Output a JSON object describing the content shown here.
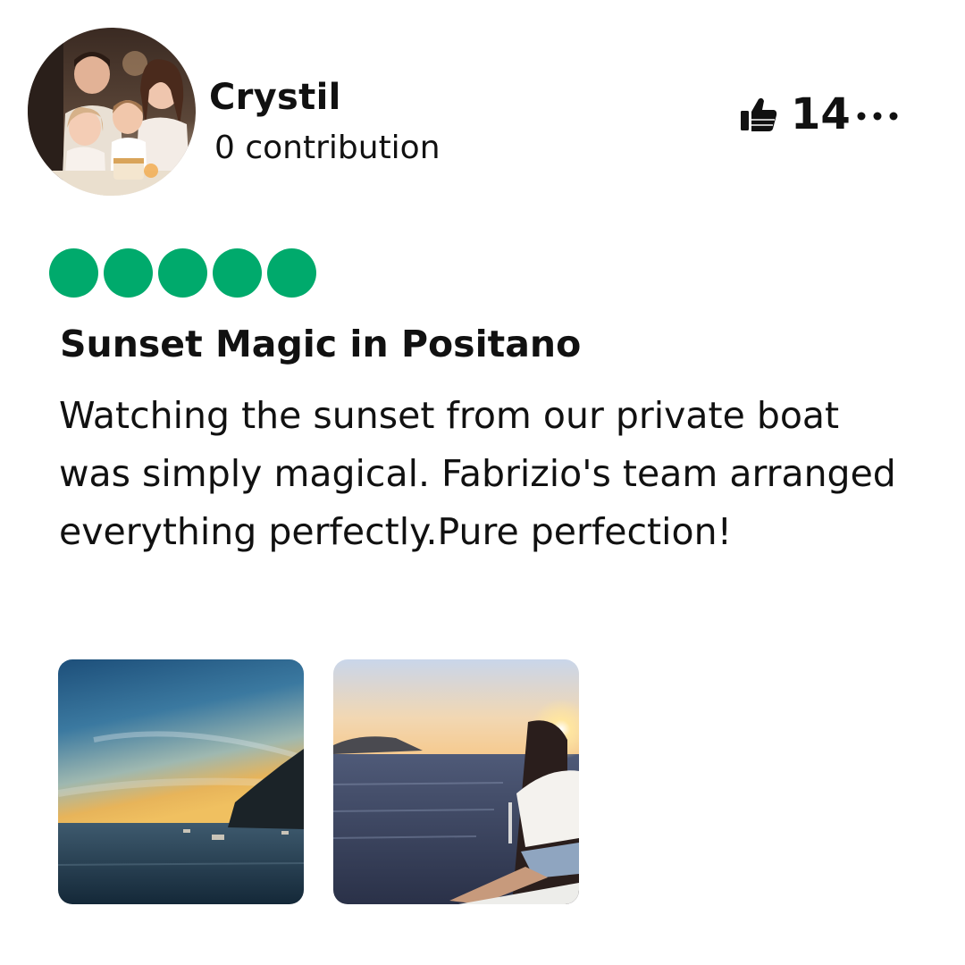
{
  "user": {
    "name": "Crystil",
    "contributions": "0 contribution"
  },
  "helpful": {
    "icon": "thumbs-up-icon",
    "count": "14"
  },
  "more_icon": "ellipsis-icon",
  "rating": {
    "value": 5,
    "max": 5,
    "color": "#00aa6c"
  },
  "review": {
    "title": "Sunset Magic in Positano",
    "body": "Watching the sunset from our private boat was simply magical. Fabrizio's team arranged everything perfectly.Pure perfection!"
  },
  "photos": [
    "sunset-coast-photo",
    "woman-on-boat-photo"
  ]
}
